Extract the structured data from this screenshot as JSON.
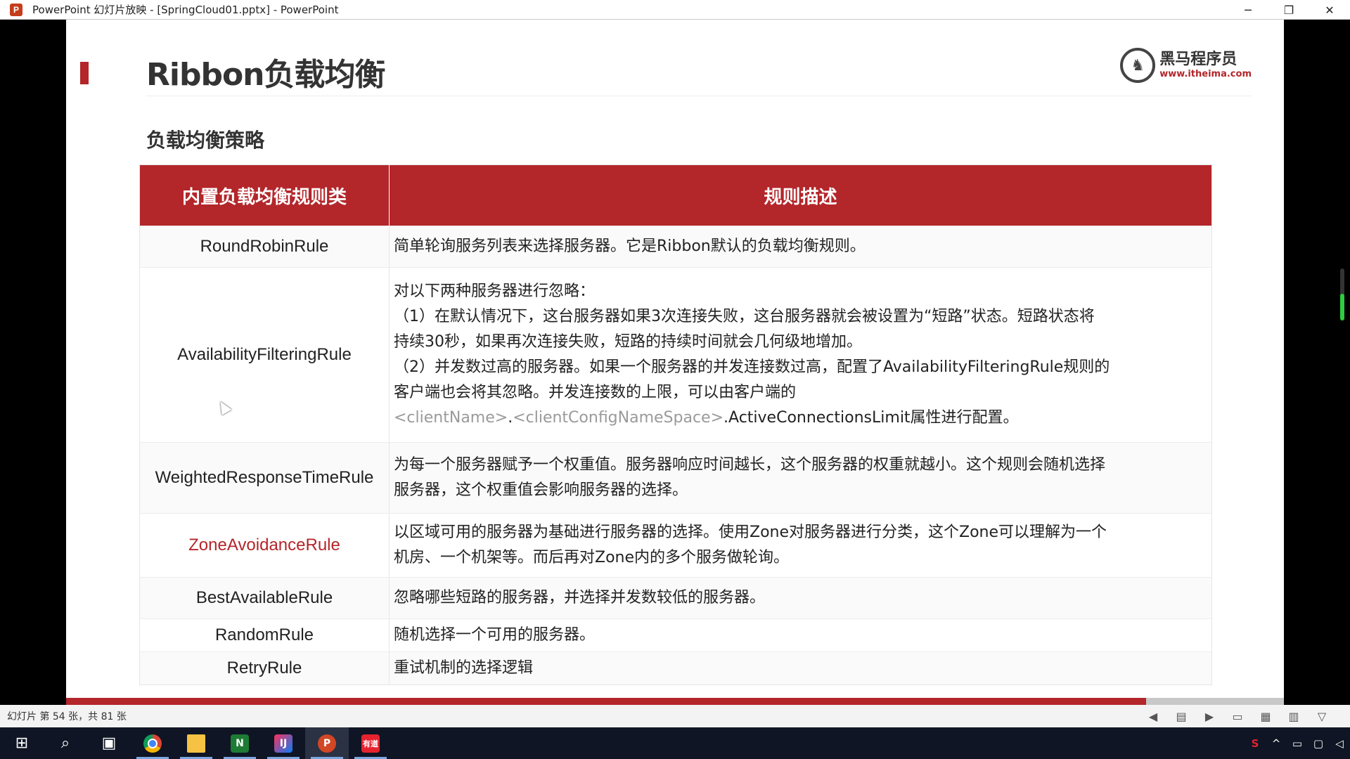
{
  "window": {
    "app_icon_letter": "P",
    "title": "PowerPoint 幻灯片放映 - [SpringCloud01.pptx] - PowerPoint",
    "minimize": "─",
    "restore": "❐",
    "close": "✕"
  },
  "slide": {
    "title": "Ribbon负载均衡",
    "logo_cn": "黑马程序员",
    "logo_url": "www.itheima.com",
    "section_title": "负载均衡策略",
    "table": {
      "headers": [
        "内置负载均衡规则类",
        "规则描述"
      ],
      "rows": [
        {
          "name": "RoundRobinRule",
          "lines": [
            "简单轮询服务列表来选择服务器。它是Ribbon默认的负载均衡规则。"
          ]
        },
        {
          "name": "AvailabilityFilteringRule",
          "lines": [
            "对以下两种服务器进行忽略：",
            "（1）在默认情况下，这台服务器如果3次连接失败，这台服务器就会被设置为“短路”状态。短路状态将",
            "持续30秒，如果再次连接失败，短路的持续时间就会几何级地增加。",
            "（2）并发数过高的服务器。如果一个服务器的并发连接数过高，配置了AvailabilityFilteringRule规则的",
            "客户端也会将其忽略。并发连接数的上限，可以由客户端的"
          ],
          "last_line": {
            "part1": "<clientName>",
            "dot": ".",
            "part2": "<clientConfigNameSpace>",
            "rest": ".ActiveConnectionsLimit属性进行配置。"
          }
        },
        {
          "name": "WeightedResponseTimeRule",
          "lines": [
            "为每一个服务器赋予一个权重值。服务器响应时间越长，这个服务器的权重就越小。这个规则会随机选择",
            "服务器，这个权重值会影响服务器的选择。"
          ]
        },
        {
          "name": "ZoneAvoidanceRule",
          "lines": [
            "以区域可用的服务器为基础进行服务器的选择。使用Zone对服务器进行分类，这个Zone可以理解为一个",
            "机房、一个机架等。而后再对Zone内的多个服务做轮询。"
          ]
        },
        {
          "name": "BestAvailableRule",
          "lines": [
            "忽略哪些短路的服务器，并选择并发数较低的服务器。"
          ]
        },
        {
          "name": "RandomRule",
          "lines": [
            "随机选择一个可用的服务器。"
          ]
        },
        {
          "name": "RetryRule",
          "lines": [
            "重试机制的选择逻辑"
          ]
        }
      ]
    }
  },
  "statusbar": {
    "slide_info": "幻灯片 第 54 张，共 81 张"
  },
  "colors": {
    "accent": "#b3262a",
    "title_text": "#333333"
  },
  "taskbar": {
    "items": [
      "windows-start",
      "search",
      "task-view",
      "chrome",
      "file-explorer",
      "onenote",
      "intellij-idea",
      "powerpoint",
      "youdao"
    ],
    "youdao_label": "有道"
  }
}
